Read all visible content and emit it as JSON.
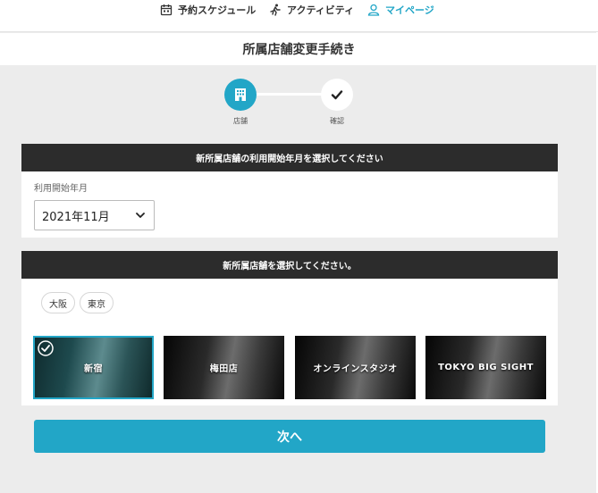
{
  "nav": {
    "items": [
      {
        "label": "予約スケジュール",
        "icon": "calendar-icon"
      },
      {
        "label": "アクティビティ",
        "icon": "running-icon"
      },
      {
        "label": "マイページ",
        "icon": "user-icon",
        "active": true
      }
    ]
  },
  "page": {
    "title": "所属店舗変更手続き"
  },
  "stepper": {
    "steps": [
      {
        "label": "店舗",
        "icon": "building-icon",
        "active": true
      },
      {
        "label": "確認",
        "icon": "check-icon"
      }
    ]
  },
  "month_section": {
    "header": "新所属店舗の利用開始年月を選択してください",
    "field_label": "利用開始年月",
    "selected": "2021年11月"
  },
  "store_section": {
    "header": "新所属店舗を選択してください。",
    "regions": [
      "大阪",
      "東京"
    ],
    "stores": [
      {
        "name": "新宿",
        "selected": true
      },
      {
        "name": "梅田店"
      },
      {
        "name": "オンラインスタジオ"
      },
      {
        "name": "TOKYO BIG SIGHT"
      }
    ]
  },
  "next_button": {
    "label": "次へ"
  },
  "colors": {
    "accent": "#22a6c7",
    "header_bg": "#2c2c2c",
    "page_bg": "#ececec"
  }
}
